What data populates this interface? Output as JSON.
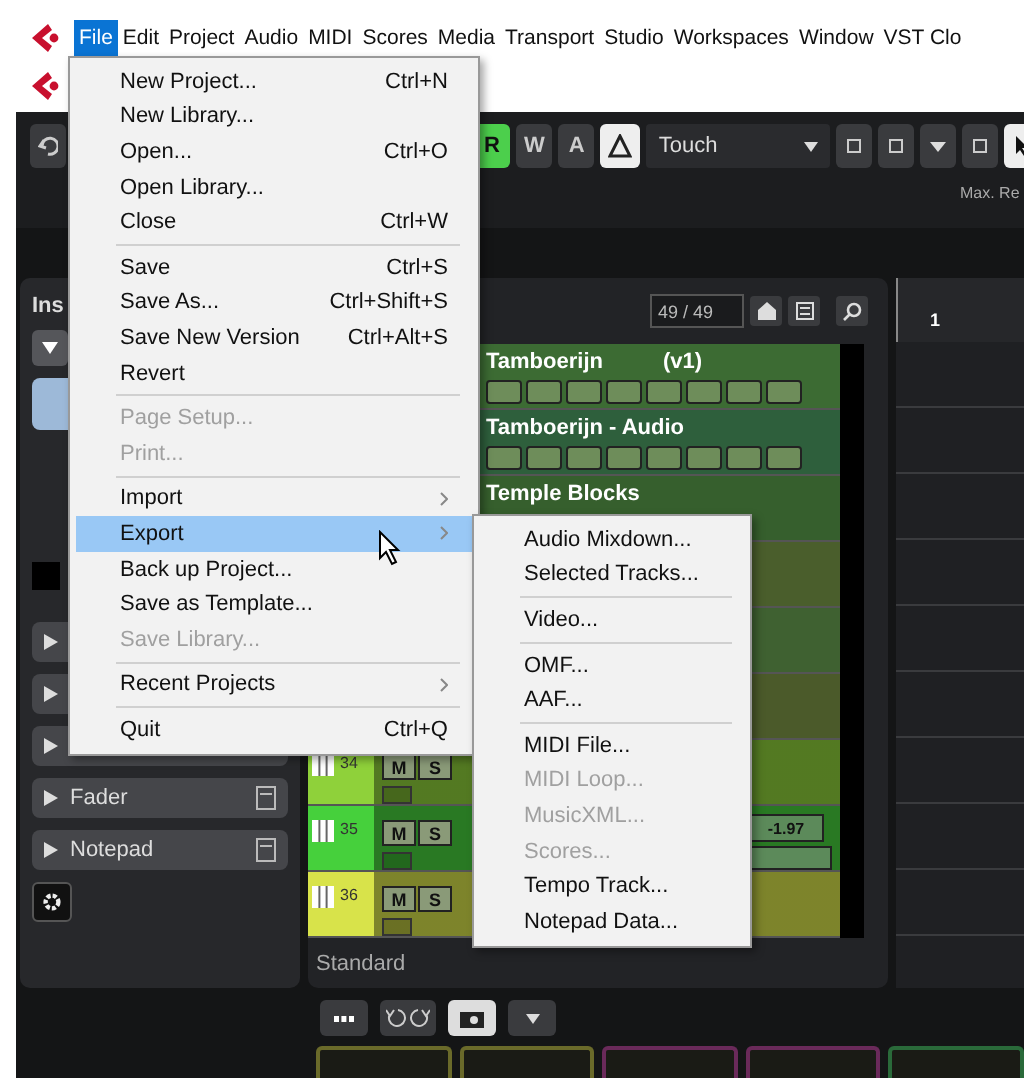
{
  "menubar": [
    {
      "label": "File",
      "selected": true
    },
    {
      "label": "Edit",
      "selected": false
    },
    {
      "label": "Project",
      "selected": false
    },
    {
      "label": "Audio",
      "selected": false
    },
    {
      "label": "MIDI",
      "selected": false
    },
    {
      "label": "Scores",
      "selected": false
    },
    {
      "label": "Media",
      "selected": false
    },
    {
      "label": "Transport",
      "selected": false
    },
    {
      "label": "Studio",
      "selected": false
    },
    {
      "label": "Workspaces",
      "selected": false
    },
    {
      "label": "Window",
      "selected": false
    },
    {
      "label": "VST Clo",
      "selected": false
    }
  ],
  "toolbar": {
    "automation_buttons": [
      {
        "label": "R",
        "on": true
      },
      {
        "label": "W",
        "on": false
      },
      {
        "label": "A",
        "on": false
      }
    ],
    "automation_mode": "Touch",
    "max_label": "Max. Re"
  },
  "inspector": {
    "title": "Ins",
    "sections": [
      {
        "expanded": false
      },
      {
        "expanded": false
      },
      {
        "expanded": false
      },
      {
        "label": "Fader",
        "expanded": false
      },
      {
        "label": "Notepad",
        "expanded": false
      }
    ]
  },
  "track_list": {
    "count": "49 / 49",
    "footer": "Standard",
    "tracks": [
      {
        "name": "Tamboerijn",
        "version": "(v1)",
        "color": "#3c6b33",
        "controls": true
      },
      {
        "name": "Tamboerijn - Audio",
        "color": "#2e5f3c",
        "controls": true
      },
      {
        "name": "Temple Blocks",
        "color": "#365f2d"
      },
      {
        "color": "#4a5e2c"
      },
      {
        "color": "#3f6131"
      },
      {
        "color": "#4b5a2a"
      },
      {
        "number": "34",
        "color": "#8fd13a",
        "buttons": [
          "M",
          "S"
        ]
      },
      {
        "number": "35",
        "color": "#46d03c",
        "buttons": [
          "M",
          "S"
        ],
        "value": "-1.97"
      },
      {
        "number": "36",
        "color": "#d8e34a",
        "buttons": [
          "M",
          "S"
        ]
      }
    ]
  },
  "ruler": {
    "marker": "1"
  },
  "file_menu": [
    [
      {
        "label": "New Project...",
        "shortcut": "Ctrl+N"
      },
      {
        "label": "New Library..."
      },
      {
        "label": "Open...",
        "shortcut": "Ctrl+O"
      },
      {
        "label": "Open Library..."
      },
      {
        "label": "Close",
        "shortcut": "Ctrl+W"
      }
    ],
    [
      {
        "label": "Save",
        "shortcut": "Ctrl+S"
      },
      {
        "label": "Save As...",
        "shortcut": "Ctrl+Shift+S"
      },
      {
        "label": "Save New Version",
        "shortcut": "Ctrl+Alt+S"
      },
      {
        "label": "Revert"
      }
    ],
    [
      {
        "label": "Page Setup...",
        "disabled": true
      },
      {
        "label": "Print...",
        "disabled": true
      }
    ],
    [
      {
        "label": "Import",
        "submenu": true,
        "selected": false
      },
      {
        "label": "Export",
        "submenu": true,
        "selected": true
      },
      {
        "label": "Back up Project..."
      },
      {
        "label": "Save as Template..."
      },
      {
        "label": "Save Library...",
        "disabled": true
      }
    ],
    [
      {
        "label": "Recent Projects",
        "submenu": true,
        "selected": false
      }
    ],
    [
      {
        "label": "Quit",
        "shortcut": "Ctrl+Q"
      }
    ]
  ],
  "export_menu": [
    [
      {
        "label": "Audio Mixdown..."
      },
      {
        "label": "Selected Tracks..."
      }
    ],
    [
      {
        "label": "Video..."
      }
    ],
    [
      {
        "label": "OMF..."
      },
      {
        "label": "AAF..."
      }
    ],
    [
      {
        "label": "MIDI File..."
      },
      {
        "label": "MIDI Loop...",
        "disabled": true
      },
      {
        "label": "MusicXML...",
        "disabled": true
      },
      {
        "label": "Scores...",
        "disabled": true
      },
      {
        "label": "Tempo Track..."
      },
      {
        "label": "Notepad Data..."
      }
    ]
  ]
}
